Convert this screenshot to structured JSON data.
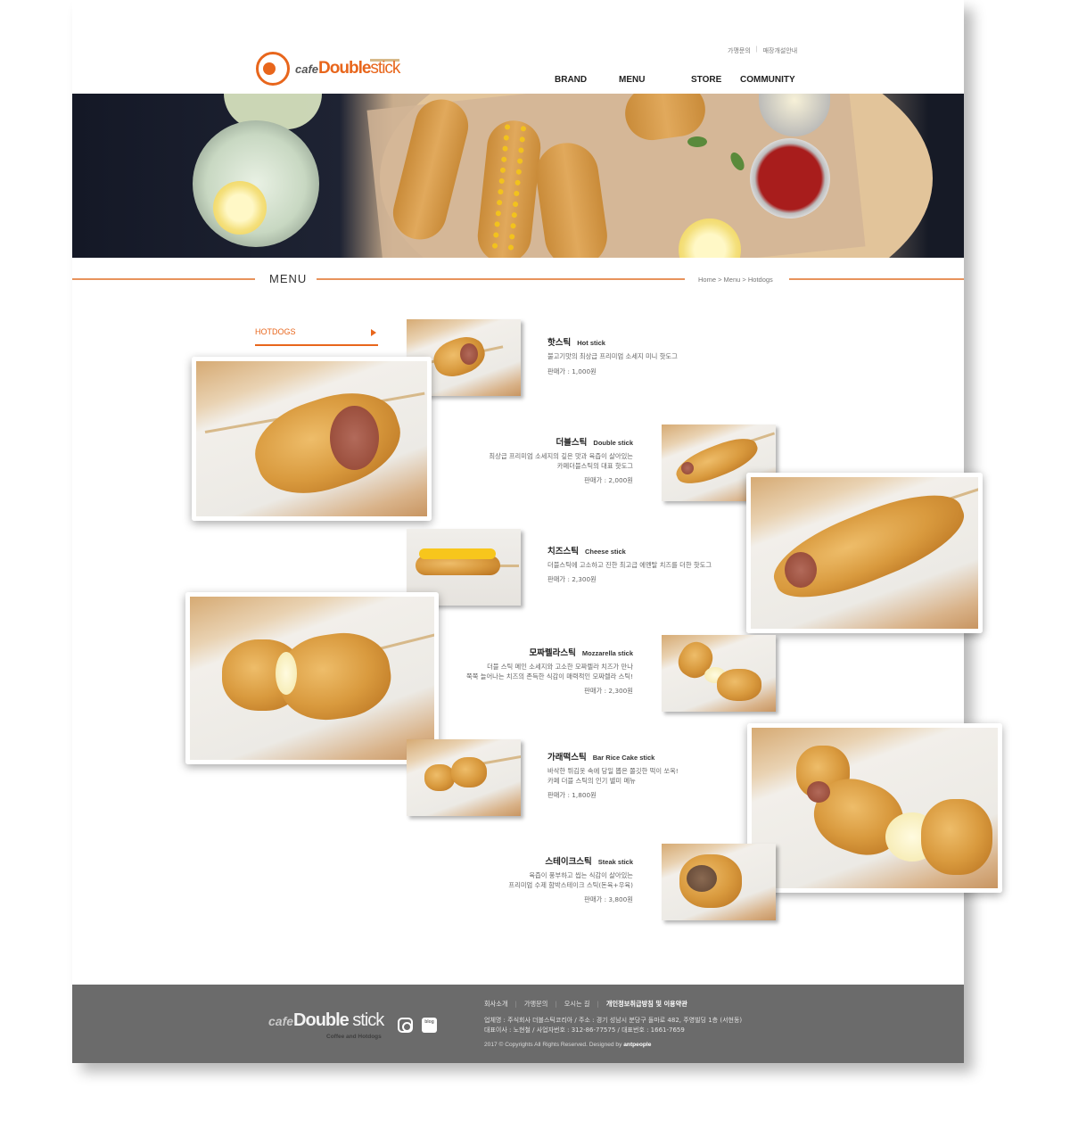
{
  "header": {
    "logo": {
      "cafe": "cafe",
      "double": "Double",
      "stick": "stick",
      "badge": "Cafe Double Stick"
    },
    "util_links": [
      "가맹문의",
      "매장개설안내"
    ],
    "nav": [
      "BRAND",
      "MENU",
      "STORE",
      "COMMUNITY"
    ]
  },
  "section": {
    "title": "MENU",
    "breadcrumb": "Home > Menu > Hotdogs"
  },
  "side_menu": {
    "active": "HOTDOGS"
  },
  "products": [
    {
      "name": "핫스틱",
      "en": "Hot stick",
      "desc": [
        "불고기맛의 최상급 프리미엄 소세지 미니 핫도그"
      ],
      "price": "판매가 : 1,000원"
    },
    {
      "name": "더블스틱",
      "en": "Double stick",
      "desc": [
        "최상급 프리미엄 소세지의 깊은 맛과 육즙이 살아있는",
        "카페더블스틱의 대표 핫도그"
      ],
      "price": "판매가 : 2,000원"
    },
    {
      "name": "치즈스틱",
      "en": "Cheese stick",
      "desc": [
        "더블스틱에 고소하고 진한 최고급 에멘탈 치즈를 더한 핫도그"
      ],
      "price": "판매가 : 2,300원"
    },
    {
      "name": "모짜렐라스틱",
      "en": "Mozzarella stick",
      "desc": [
        "더블 스틱 메인 소세지와 고소한 모짜렐라 치즈가 만나",
        "쭉쭉 늘어나는 치즈의 존득한 식감이 매력적인 모짜렐라 스틱!"
      ],
      "price": "판매가 : 2,300원"
    },
    {
      "name": "가래떡스틱",
      "en": "Bar Rice Cake stick",
      "desc": [
        "바삭한 튀김옷 속에 당일 뽑은 쫄깃한 떡이 쏘옥!",
        "카페 더블 스틱의 인기 별미 메뉴"
      ],
      "price": "판매가 : 1,800원"
    },
    {
      "name": "스테이크스틱",
      "en": "Steak stick",
      "desc": [
        "육즙이 풍부하고 씹는 식감이 살아있는",
        "프리미엄 수제 함박스테이크 스틱(돈육+우육)"
      ],
      "price": "판매가 : 3,800원"
    }
  ],
  "footer": {
    "logo": {
      "cafe": "cafe",
      "double": "Double",
      "stick": "stick",
      "sub": "Coffee and Hotdogs"
    },
    "links": [
      "회사소개",
      "가맹문의",
      "오시는 길",
      "개인정보취급방침 및 이용약관"
    ],
    "info1": "업체명 : 주식회사 더블스틱코리아 / 주소 : 경기 성남시 분당구 돌마로 482, 주영빌딩 1층 (서현동)",
    "info2": "대표이사 : 노현철 / 사업자번호 : 312-86-77575 / 대표번호 : 1661-7659",
    "copyright": "2017 © Copyrights All Rights Reserved. Designed by",
    "designer": "antpeople",
    "blog_label": "blog"
  }
}
